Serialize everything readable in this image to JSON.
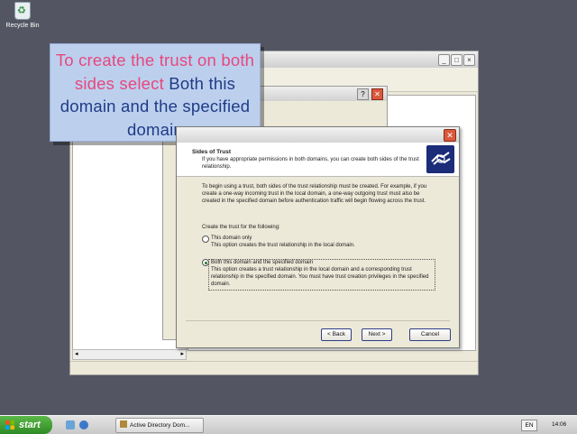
{
  "desktop": {
    "recycle_bin_label": "Recycle Bin"
  },
  "callout": {
    "text_part1": "To create the trust on both sides select",
    "text_part2": "Both this domain and the specified domain"
  },
  "wizard": {
    "close_glyph": "✕",
    "header_title": "Sides of Trust",
    "header_subtitle": "If you have appropriate permissions in both domains, you can create both sides of the trust relationship.",
    "intro_text": "To begin using a trust, both sides of the trust relationship must be created. For example, if you create a one-way incoming trust in the local domain, a one-way outgoing trust must also be created in the specified domain before authentication traffic will begin flowing across the trust.",
    "create_label": "Create the trust for the following:",
    "option1": {
      "label": "This domain only",
      "description": "This option creates the trust relationship in the local domain.",
      "selected": false
    },
    "option2": {
      "label": "Both this domain and the specified domain",
      "description": "This option creates a trust relationship in the local domain and a corresponding trust relationship in the specified domain. You must have trust creation privileges in the specified domain.",
      "selected": true
    },
    "back_button": "< Back",
    "next_button": "Next >",
    "cancel_button": "Cancel"
  },
  "mid_dialog": {
    "help_glyph": "?",
    "close_glyph": "✕"
  },
  "taskbar": {
    "start_label": "start",
    "task_button_label": "Active Directory Dom...",
    "language": "EN",
    "clock": "14:06"
  },
  "colors": {
    "desktop": "#535662",
    "callout_bg": "#bcd0ee",
    "callout_pink": "#e8477e",
    "callout_blue": "#1f3b86",
    "taskbar": "#d6d6d6",
    "start_green": "#3a9a2f"
  }
}
